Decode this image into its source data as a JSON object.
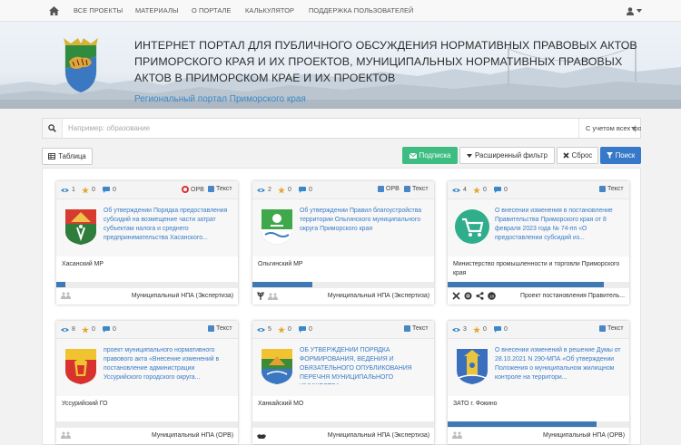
{
  "nav": {
    "items": [
      "ВСЕ ПРОЕКТЫ",
      "МАТЕРИАЛЫ",
      "О ПОРТАЛЕ",
      "КАЛЬКУЛЯТОР",
      "ПОДДЕРЖКА ПОЛЬЗОВАТЕЛЕЙ"
    ]
  },
  "banner": {
    "title": "ИНТЕРНЕТ ПОРТАЛ ДЛЯ ПУБЛИЧНОГО ОБСУЖДЕНИЯ НОРМАТИВНЫХ ПРАВОВЫХ АКТОВ ПРИМОРСКОГО КРАЯ И ИХ ПРОЕКТОВ, МУНИЦИПАЛЬНЫХ НОРМАТИВНЫХ ПРАВОВЫХ АКТОВ В ПРИМОРСКОМ КРАЕ И ИХ ПРОЕКТОВ",
    "subtitle": "Региональный портал Приморского края"
  },
  "search": {
    "placeholder": "Например: образование",
    "mode": "С учетом всех форм слов"
  },
  "toolbar": {
    "table": "Таблица",
    "subscribe": "Подписка",
    "filter": "Расширенный фильтр",
    "reset": "Сброс",
    "search": "Поиск"
  },
  "colors": {
    "accent": "#3579c8",
    "green": "#3dbd82",
    "link": "#3a7cc6"
  },
  "cards": [
    {
      "views": "1",
      "stars": "0",
      "comments": "0",
      "orv": true,
      "orv_label": "ОРВ",
      "tag": "Текст",
      "logo": "khasan",
      "text": "Об утверждении Порядка предоставления субсидий на возмещение части затрат субъектам налога и среднего предпринимательства Хасанского...",
      "org": "Хасанский МР",
      "progress": 0.05,
      "type": "Муниципальный НПА (Экспертиза)",
      "foot_icons": [
        "meeting-icon"
      ]
    },
    {
      "views": "2",
      "stars": "0",
      "comments": "0",
      "orv": false,
      "orv_label": "ОРВ",
      "tag": "Текст",
      "logo": "olga",
      "text": "Об утверждении Правил благоустройства территории Ольгинского муниципального округа Приморского края",
      "org": "Ольгинский МР",
      "progress": 0.33,
      "type": "Муниципальный НПА (Экспертиза)",
      "foot_icons": [
        "plant-icon",
        "meeting-icon"
      ]
    },
    {
      "views": "4",
      "stars": "0",
      "comments": "0",
      "orv": false,
      "orv_label": "",
      "tag": "Текст",
      "logo": "cart",
      "text": "О внесении изменения в постановление Правительства Приморского края от 8 февраля 2023 года № 74-пп «О предоставлении субсидий из...",
      "org": "Министерство промышленности и торговли Приморского края",
      "progress": 0.86,
      "type": "Проект постановления Правитель...",
      "foot_icons": [
        "tools-icon",
        "gear-icon",
        "share-icon",
        "badge-icon"
      ]
    },
    {
      "views": "8",
      "stars": "0",
      "comments": "0",
      "orv": false,
      "orv_label": "",
      "tag": "Текст",
      "logo": "ussuri",
      "text": "проект муниципального нормативного правового акта «Внесение изменений в постановление администрации Уссурийского городского округа...",
      "org": "Уссурийский ГО",
      "progress": 0.0,
      "type": "Муниципальный НПА (ОРВ)",
      "foot_icons": [
        "meeting-icon"
      ]
    },
    {
      "views": "5",
      "stars": "0",
      "comments": "0",
      "orv": false,
      "orv_label": "",
      "tag": "Текст",
      "logo": "khanka",
      "text": "ОБ УТВЕРЖДЕНИИ ПОРЯДКА ФОРМИРОВАНИЯ, ВЕДЕНИЯ И ОБЯЗАТЕЛЬНОГО ОПУБЛИКОВАНИЯ ПЕРЕЧНЯ МУНИЦИПАЛЬНОГО ИМУЩЕСТВА",
      "org": "Ханкайский МО",
      "progress": 0.0,
      "type": "Муниципальный НПА (Экспертиза)",
      "foot_icons": [
        "hands-icon"
      ]
    },
    {
      "views": "3",
      "stars": "0",
      "comments": "0",
      "orv": false,
      "orv_label": "",
      "tag": "Текст",
      "logo": "fokino",
      "text": "О внесении изменений в решение Думы от 28.10.2021 N 290-МПА «Об утверждении Положения о муниципальном жилищном контроле на территори...",
      "org": "ЗАТО г. Фокино",
      "progress": 0.82,
      "type": "Муниципальный НПА (ОРВ)",
      "foot_icons": [
        "meeting-icon"
      ]
    }
  ]
}
